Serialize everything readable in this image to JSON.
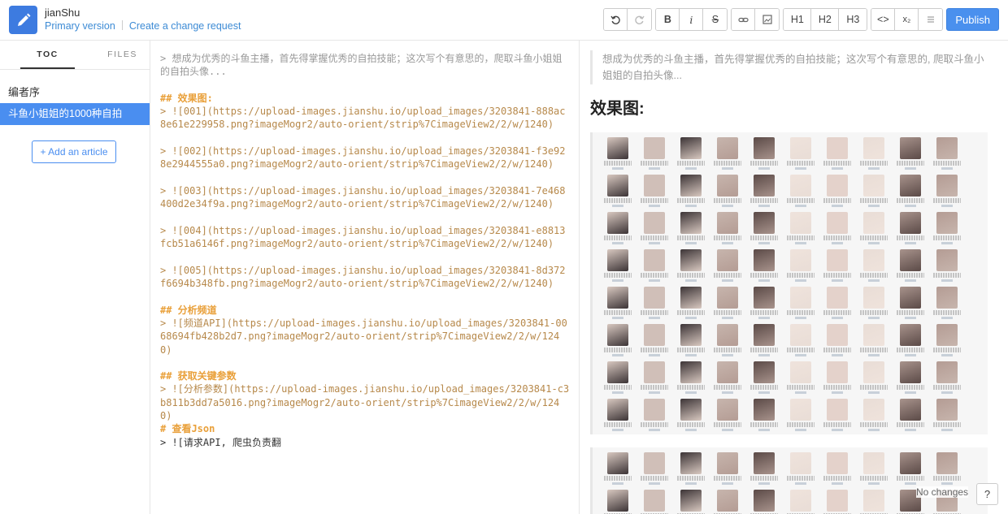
{
  "app": {
    "title": "jianShu",
    "primary_version": "Primary version",
    "change_request": "Create a change request"
  },
  "toolbar": {
    "undo_icon": "undo-icon",
    "redo_icon": "redo-icon",
    "bold": "B",
    "italic": "i",
    "strike": "S",
    "h1": "H1",
    "h2": "H2",
    "h3": "H3",
    "code": "<>",
    "subscript": "x₂",
    "publish": "Publish"
  },
  "sidebar": {
    "tabs": [
      "TOC",
      "FILES"
    ],
    "group": "编者序",
    "items": [
      "斗鱼小姐姐的1000种自拍"
    ],
    "add_article": "+ Add an article"
  },
  "editor": {
    "lines": [
      {
        "cls": "quote",
        "text": "> 想成为优秀的斗鱼主播，首先得掌握优秀的自拍技能；这次写个有意思的，爬取斗鱼小姐姐的自拍头像..."
      },
      {
        "cls": "gap",
        "text": ""
      },
      {
        "cls": "heading",
        "text": "## 效果图:"
      },
      {
        "cls": "link-text",
        "text": "> ![001](https://upload-images.jianshu.io/upload_images/3203841-888ac8e61e229958.png?imageMogr2/auto-orient/strip%7CimageView2/2/w/1240)"
      },
      {
        "cls": "gap",
        "text": ""
      },
      {
        "cls": "link-text",
        "text": "> ![002](https://upload-images.jianshu.io/upload_images/3203841-f3e928e2944555a0.png?imageMogr2/auto-orient/strip%7CimageView2/2/w/1240)"
      },
      {
        "cls": "gap",
        "text": ""
      },
      {
        "cls": "link-text",
        "text": "> ![003](https://upload-images.jianshu.io/upload_images/3203841-7e468400d2e34f9a.png?imageMogr2/auto-orient/strip%7CimageView2/2/w/1240)"
      },
      {
        "cls": "gap",
        "text": ""
      },
      {
        "cls": "link-text",
        "text": "> ![004](https://upload-images.jianshu.io/upload_images/3203841-e8813fcb51a6146f.png?imageMogr2/auto-orient/strip%7CimageView2/2/w/1240)"
      },
      {
        "cls": "gap",
        "text": ""
      },
      {
        "cls": "link-text",
        "text": "> ![005](https://upload-images.jianshu.io/upload_images/3203841-8d372f6694b348fb.png?imageMogr2/auto-orient/strip%7CimageView2/2/w/1240)"
      },
      {
        "cls": "gap",
        "text": ""
      },
      {
        "cls": "heading",
        "text": "## 分析频道"
      },
      {
        "cls": "link-text",
        "text": "> ![频道API](https://upload-images.jianshu.io/upload_images/3203841-0068694fb428b2d7.png?imageMogr2/auto-orient/strip%7CimageView2/2/w/1240)"
      },
      {
        "cls": "gap",
        "text": ""
      },
      {
        "cls": "heading",
        "text": "## 获取关键参数"
      },
      {
        "cls": "link-text",
        "text": "> ![分析参数](https://upload-images.jianshu.io/upload_images/3203841-c3b811b3dd7a5016.png?imageMogr2/auto-orient/strip%7CimageView2/2/w/1240)"
      },
      {
        "cls": "heading",
        "text": "# 查看Json"
      },
      {
        "cls": "txt",
        "text": "> ![请求API, 爬虫负责翻"
      }
    ]
  },
  "preview": {
    "quote": "想成为优秀的斗鱼主播，首先得掌握优秀的自拍技能；这次写个有意思的, 爬取斗鱼小姐姐的自拍头像...",
    "heading": "效果图:"
  },
  "status": {
    "no_changes": "No changes",
    "help": "?"
  },
  "colors": {
    "accent": "#4a8ef0",
    "logo_bg": "#3d7be0",
    "heading": "#e9a03a",
    "link": "#b7894b"
  }
}
